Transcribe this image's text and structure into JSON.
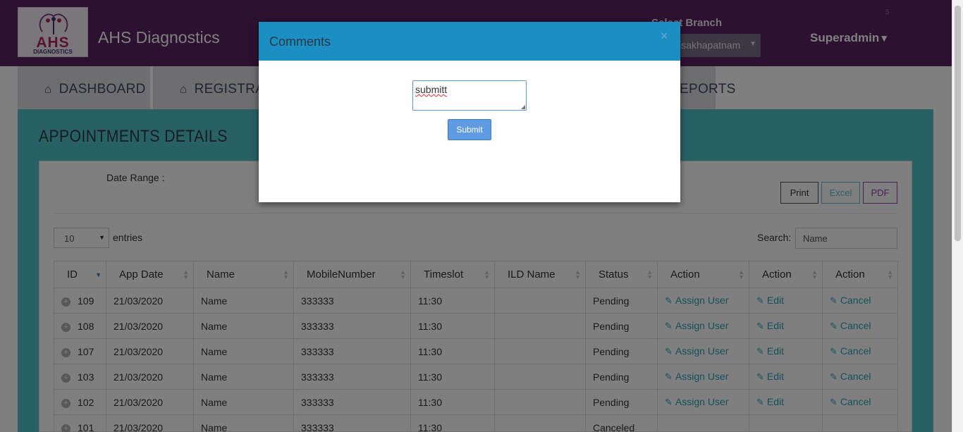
{
  "header": {
    "logo_text": "AHS",
    "logo_sub": "DIAGNOSTICS",
    "brand": "AHS Diagnostics",
    "branch_label": "Select Branch",
    "branch_value": "Visakhapatnam",
    "user": "Superadmin",
    "tiny": "5"
  },
  "nav": {
    "items": [
      {
        "label": "DASHBOARD",
        "icon": "home-icon"
      },
      {
        "label": "REGISTRATION",
        "icon": "home-icon"
      },
      {
        "label": "REPORTS",
        "icon": "file-icon"
      }
    ]
  },
  "main": {
    "title": "APPOINTMENTS DETAILS",
    "date_range_label": "Date Range :",
    "buttons": {
      "print": "Print",
      "excel": "Excel",
      "pdf": "PDF"
    },
    "entries_value": "10",
    "entries_label": "entries",
    "search_label": "Search:",
    "search_placeholder": "Name"
  },
  "table": {
    "columns": [
      "ID",
      "App Date",
      "Name",
      "MobileNumber",
      "Timeslot",
      "ILD Name",
      "Status",
      "Action",
      "Action",
      "Action"
    ],
    "rows": [
      {
        "id": "109",
        "date": "21/03/2020",
        "name": "Name",
        "mobile": "333333",
        "slot": "11:30",
        "ild": "",
        "status": "Pending",
        "a1": "Assign User",
        "a2": "Edit",
        "a3": "Cancel"
      },
      {
        "id": "108",
        "date": "21/03/2020",
        "name": "Name",
        "mobile": "333333",
        "slot": "11:30",
        "ild": "",
        "status": "Pending",
        "a1": "Assign User",
        "a2": "Edit",
        "a3": "Cancel"
      },
      {
        "id": "107",
        "date": "21/03/2020",
        "name": "Name",
        "mobile": "333333",
        "slot": "11:30",
        "ild": "",
        "status": "Pending",
        "a1": "Assign User",
        "a2": "Edit",
        "a3": "Cancel"
      },
      {
        "id": "103",
        "date": "21/03/2020",
        "name": "Name",
        "mobile": "333333",
        "slot": "11:30",
        "ild": "",
        "status": "Pending",
        "a1": "Assign User",
        "a2": "Edit",
        "a3": "Cancel"
      },
      {
        "id": "102",
        "date": "21/03/2020",
        "name": "Name",
        "mobile": "333333",
        "slot": "11:30",
        "ild": "",
        "status": "Pending",
        "a1": "Assign User",
        "a2": "Edit",
        "a3": "Cancel"
      },
      {
        "id": "101",
        "date": "21/03/2020",
        "name": "Name",
        "mobile": "333333",
        "slot": "11:30",
        "ild": "",
        "status": "Canceled",
        "a1": "",
        "a2": "",
        "a3": ""
      }
    ]
  },
  "modal": {
    "title": "Comments",
    "close": "×",
    "comment_value": "submitt",
    "submit_label": "Submit"
  },
  "colors": {
    "header_bg": "#5a2260",
    "panel_bg": "#4ec3c7",
    "modal_header": "#1b8fc3",
    "submit_bg": "#5f9be0",
    "link": "#2aa0b7"
  }
}
